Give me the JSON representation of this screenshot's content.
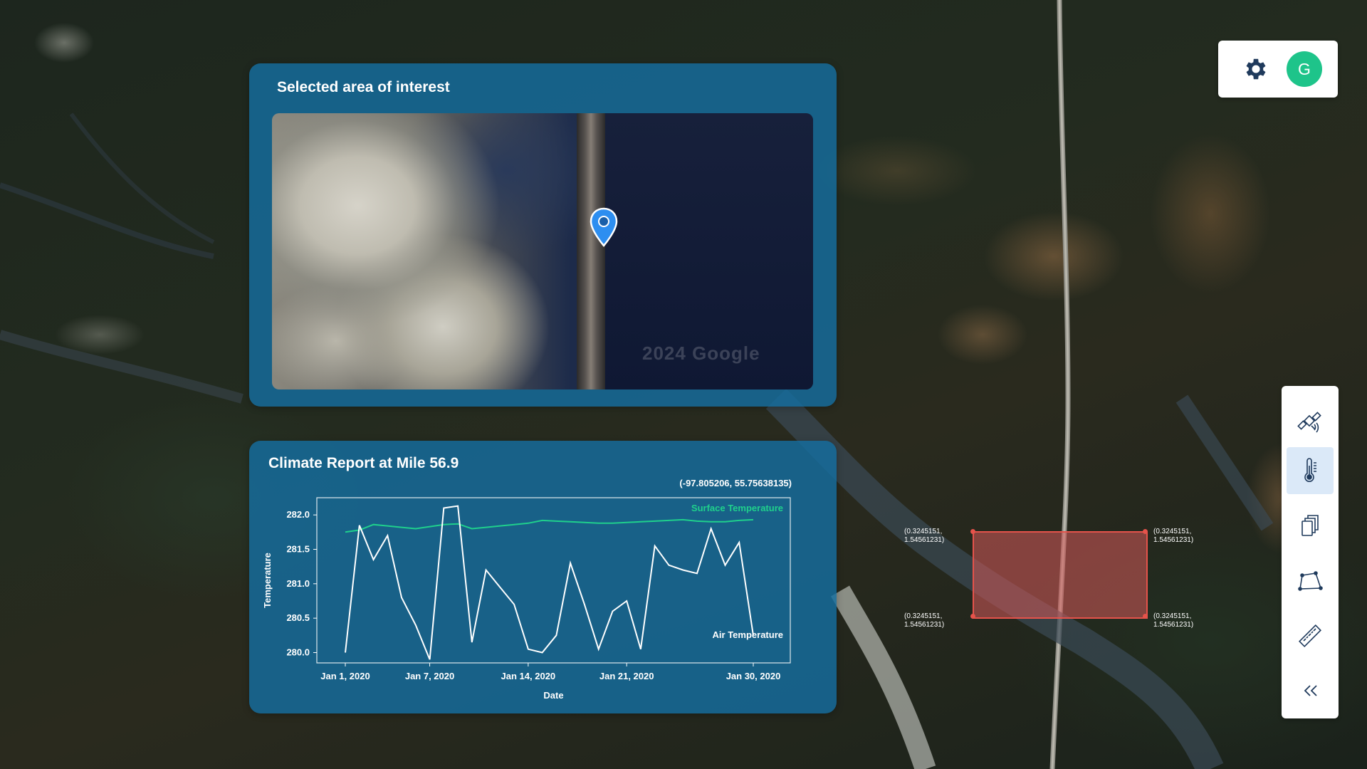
{
  "aoi": {
    "title": "Selected area of interest",
    "watermark": "2024 Google"
  },
  "climate": {
    "title": "Climate Report at Mile 56.9",
    "coordinates": "(-97.805206, 55.75638135)"
  },
  "avatar": {
    "initial": "G",
    "color": "#1ec48a"
  },
  "toolbar": {
    "tools": [
      {
        "name": "satellite",
        "icon": "satellite-icon",
        "active": false
      },
      {
        "name": "temperature",
        "icon": "thermometer-icon",
        "active": true
      },
      {
        "name": "layers",
        "icon": "copy-layers-icon",
        "active": false
      },
      {
        "name": "polygon",
        "icon": "polygon-icon",
        "active": false
      },
      {
        "name": "measure",
        "icon": "ruler-icon",
        "active": false
      },
      {
        "name": "collapse",
        "icon": "double-chevron-left-icon",
        "active": false
      }
    ]
  },
  "selection": {
    "top_left": "(0.3245151,\n1.54561231)",
    "top_right": "(0.3245151,\n1.54561231)",
    "bottom_left": "(0.3245151,\n1.54561231)",
    "bottom_right": "(0.3245151,\n1.54561231)"
  },
  "chart_data": {
    "type": "line",
    "xlabel": "Date",
    "ylabel": "Temperature",
    "ylim": [
      279.85,
      282.25
    ],
    "yticks": [
      "280.0",
      "280.5",
      "281.0",
      "281.5",
      "282.0"
    ],
    "xticks": [
      "Jan 1, 2020",
      "Jan 7, 2020",
      "Jan 14, 2020",
      "Jan 21, 2020",
      "Jan 30, 2020"
    ],
    "x": [
      "2020-01-01",
      "2020-01-02",
      "2020-01-03",
      "2020-01-04",
      "2020-01-05",
      "2020-01-06",
      "2020-01-07",
      "2020-01-08",
      "2020-01-09",
      "2020-01-10",
      "2020-01-11",
      "2020-01-12",
      "2020-01-13",
      "2020-01-14",
      "2020-01-15",
      "2020-01-16",
      "2020-01-17",
      "2020-01-18",
      "2020-01-19",
      "2020-01-20",
      "2020-01-21",
      "2020-01-22",
      "2020-01-23",
      "2020-01-24",
      "2020-01-25",
      "2020-01-26",
      "2020-01-27",
      "2020-01-28",
      "2020-01-29",
      "2020-01-30"
    ],
    "series": [
      {
        "name": "Surface Temperature",
        "color": "#1fd08c",
        "values": [
          281.75,
          281.78,
          281.86,
          281.84,
          281.82,
          281.8,
          281.83,
          281.86,
          281.87,
          281.8,
          281.82,
          281.84,
          281.86,
          281.88,
          281.92,
          281.91,
          281.9,
          281.89,
          281.88,
          281.88,
          281.89,
          281.9,
          281.91,
          281.92,
          281.93,
          281.91,
          281.9,
          281.9,
          281.92,
          281.93
        ]
      },
      {
        "name": "Air Temperature",
        "color": "#ffffff",
        "values": [
          280.0,
          281.85,
          281.35,
          281.7,
          280.8,
          280.4,
          279.9,
          282.1,
          282.13,
          280.15,
          281.2,
          280.95,
          280.7,
          280.05,
          280.0,
          280.25,
          281.3,
          280.7,
          280.05,
          280.6,
          280.75,
          280.05,
          281.55,
          281.27,
          281.2,
          281.15,
          281.8,
          281.27,
          281.6,
          280.25
        ]
      }
    ]
  }
}
